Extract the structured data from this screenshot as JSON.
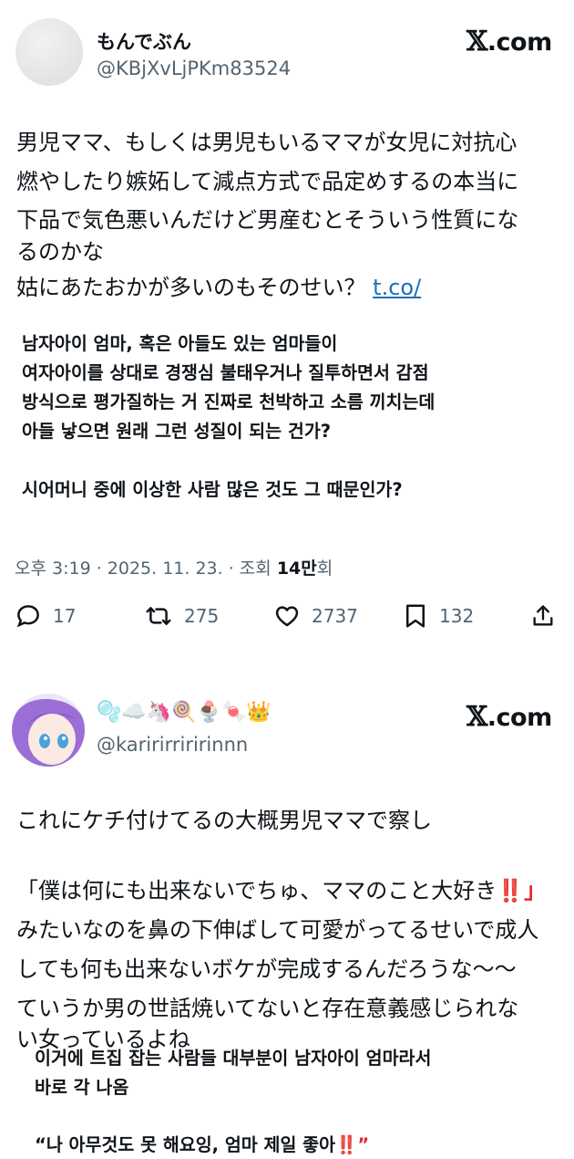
{
  "tweet1": {
    "display_name": "もんでぶん",
    "handle": "@KBjXvLjPKm83524",
    "brand_x": "𝕏",
    "brand_com": ".com",
    "jp_lines": [
      "男児ママ、もしくは男児もいるママが女児に対抗心",
      "燃やしたり嫉妬して減点方式で品定めするの本当に",
      "下品で気色悪いんだけど男産むとそういう性質にな",
      "るのかな",
      "姑にあたおかが多いのもそのせい？ "
    ],
    "link_text": "t.co/",
    "ko_lines": [
      "남자아이 엄마, 혹은 아들도 있는 엄마들이",
      "여자아이를 상대로 경쟁심 불태우거나 질투하면서 감점",
      "방식으로 평가질하는 거 진짜로 천박하고 소름 끼치는데",
      "아들 낳으면 원래 그런 성질이 되는 건가?"
    ],
    "ko_extra": "시어머니 중에 이상한 사람 많은 것도 그 때문인가?",
    "meta_prefix": "오후 3:19 · 2025. 11. 23. · 조회 ",
    "meta_views": "14만",
    "meta_suffix": "회",
    "actions": {
      "replies": "17",
      "reposts": "275",
      "likes": "2737",
      "bookmarks": "132"
    }
  },
  "tweet2": {
    "display_name_emojis": "🫧☁️🦄🍭🍨🍬👑",
    "handle": "@karirirriririnnn",
    "brand_x": "𝕏",
    "brand_com": ".com",
    "jp_lines": [
      "これにケチ付けてるの大概男児ママで察し",
      "「僕は何にも出来ないでちゅ、ママのこと大好き",
      "みたいなのを鼻の下伸ばして可愛がってるせいで成人",
      "しても何も出来ないボケが完成するんだろうな～～",
      "ていうか男の世話焼いてないと存在意義感じられな",
      "い女っているよね"
    ],
    "jp_line2_suffix": "‼️」",
    "ko_lines": [
      "이거에 트집 잡는 사람들 대부분이 남자아이 엄마라서",
      "바로 각 나옴"
    ],
    "ko_partial": "“나 아무것도 못 해요잉, 엄마 제일 좋아",
    "ko_partial_suffix": "‼️”"
  },
  "colors": {
    "text": "#0f1419",
    "muted": "#536471",
    "link": "#1d6fb8",
    "bang": "#e3242b"
  }
}
